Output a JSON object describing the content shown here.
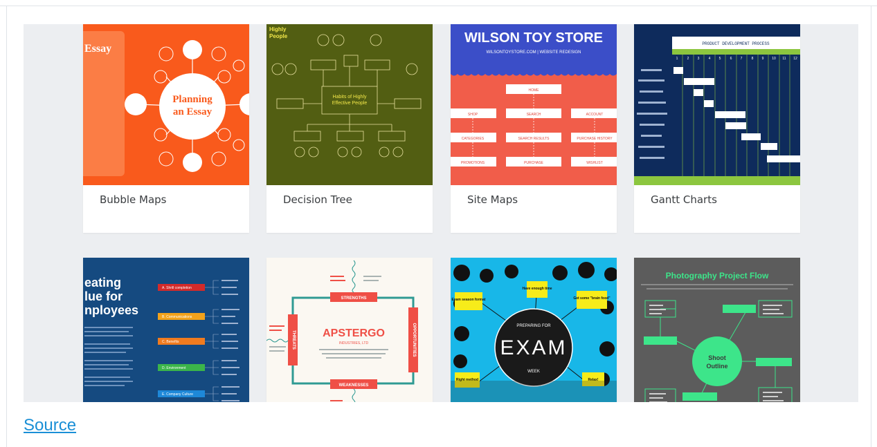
{
  "cards_row1": [
    {
      "caption": "Bubble Maps",
      "thumb_title": "Planning an Essay",
      "side_label": "Essay"
    },
    {
      "caption": "Decision Tree",
      "thumb_title": "Habits of Highly Effective People",
      "side_label": "Highly People"
    },
    {
      "caption": "Site Maps",
      "thumb_title": "WILSON TOY STORE",
      "thumb_subtitle": "WILSONTOYSTORE.COM | WEBSITE REDESIGN",
      "nodes": [
        "HOME",
        "SHOP",
        "SEARCH",
        "ACCOUNT",
        "CATEGORIES",
        "SEARCH RESULTS",
        "PURCHASE HISTORY",
        "PROMOTIONS",
        "PURCHASE",
        "WISHLIST"
      ]
    },
    {
      "caption": "Gantt Charts",
      "thumb_title": "PRODUCT DEVELOPMENT PROCESS",
      "columns": [
        "1",
        "2",
        "3",
        "4",
        "5",
        "6",
        "7",
        "8",
        "9",
        "10",
        "11",
        "12"
      ]
    }
  ],
  "cards_row2": [
    {
      "thumb_title": "eating\nlue for\nnployees",
      "items": [
        "A. Shrill completion",
        "B. Communications",
        "C. Benefits",
        "D. Environment",
        "E. Company Culture"
      ]
    },
    {
      "thumb_title": "APSTERGO",
      "thumb_subtitle": "INDUSTRIES, LTD",
      "strengths": "STRENGTHS",
      "weaknesses": "WEAKNESSES",
      "threats": "THREATS",
      "opportunities": "OPPORTUNITIES"
    },
    {
      "thumb_title": "EXAM",
      "thumb_top": "PREPARING FOR",
      "thumb_bottom": "WEEK",
      "notes": [
        "Exam season format",
        "Have enough time",
        "Get some \"brain food\"",
        "Right method",
        "Relax!"
      ]
    },
    {
      "thumb_title": "Photography Project Flow",
      "center_label": "Shoot Outline"
    }
  ],
  "source_label": "Source",
  "colors": {
    "accent_link": "#1a8fd6",
    "bubble_bg": "#f95a1c",
    "tree_bg": "#525e12",
    "sitemap_bg": "#f15d4a",
    "gantt_bg": "#0e2b5c",
    "employee_bg": "#154a80",
    "exam_bg": "#18b7e8",
    "photo_bg": "#5c5c5c"
  }
}
